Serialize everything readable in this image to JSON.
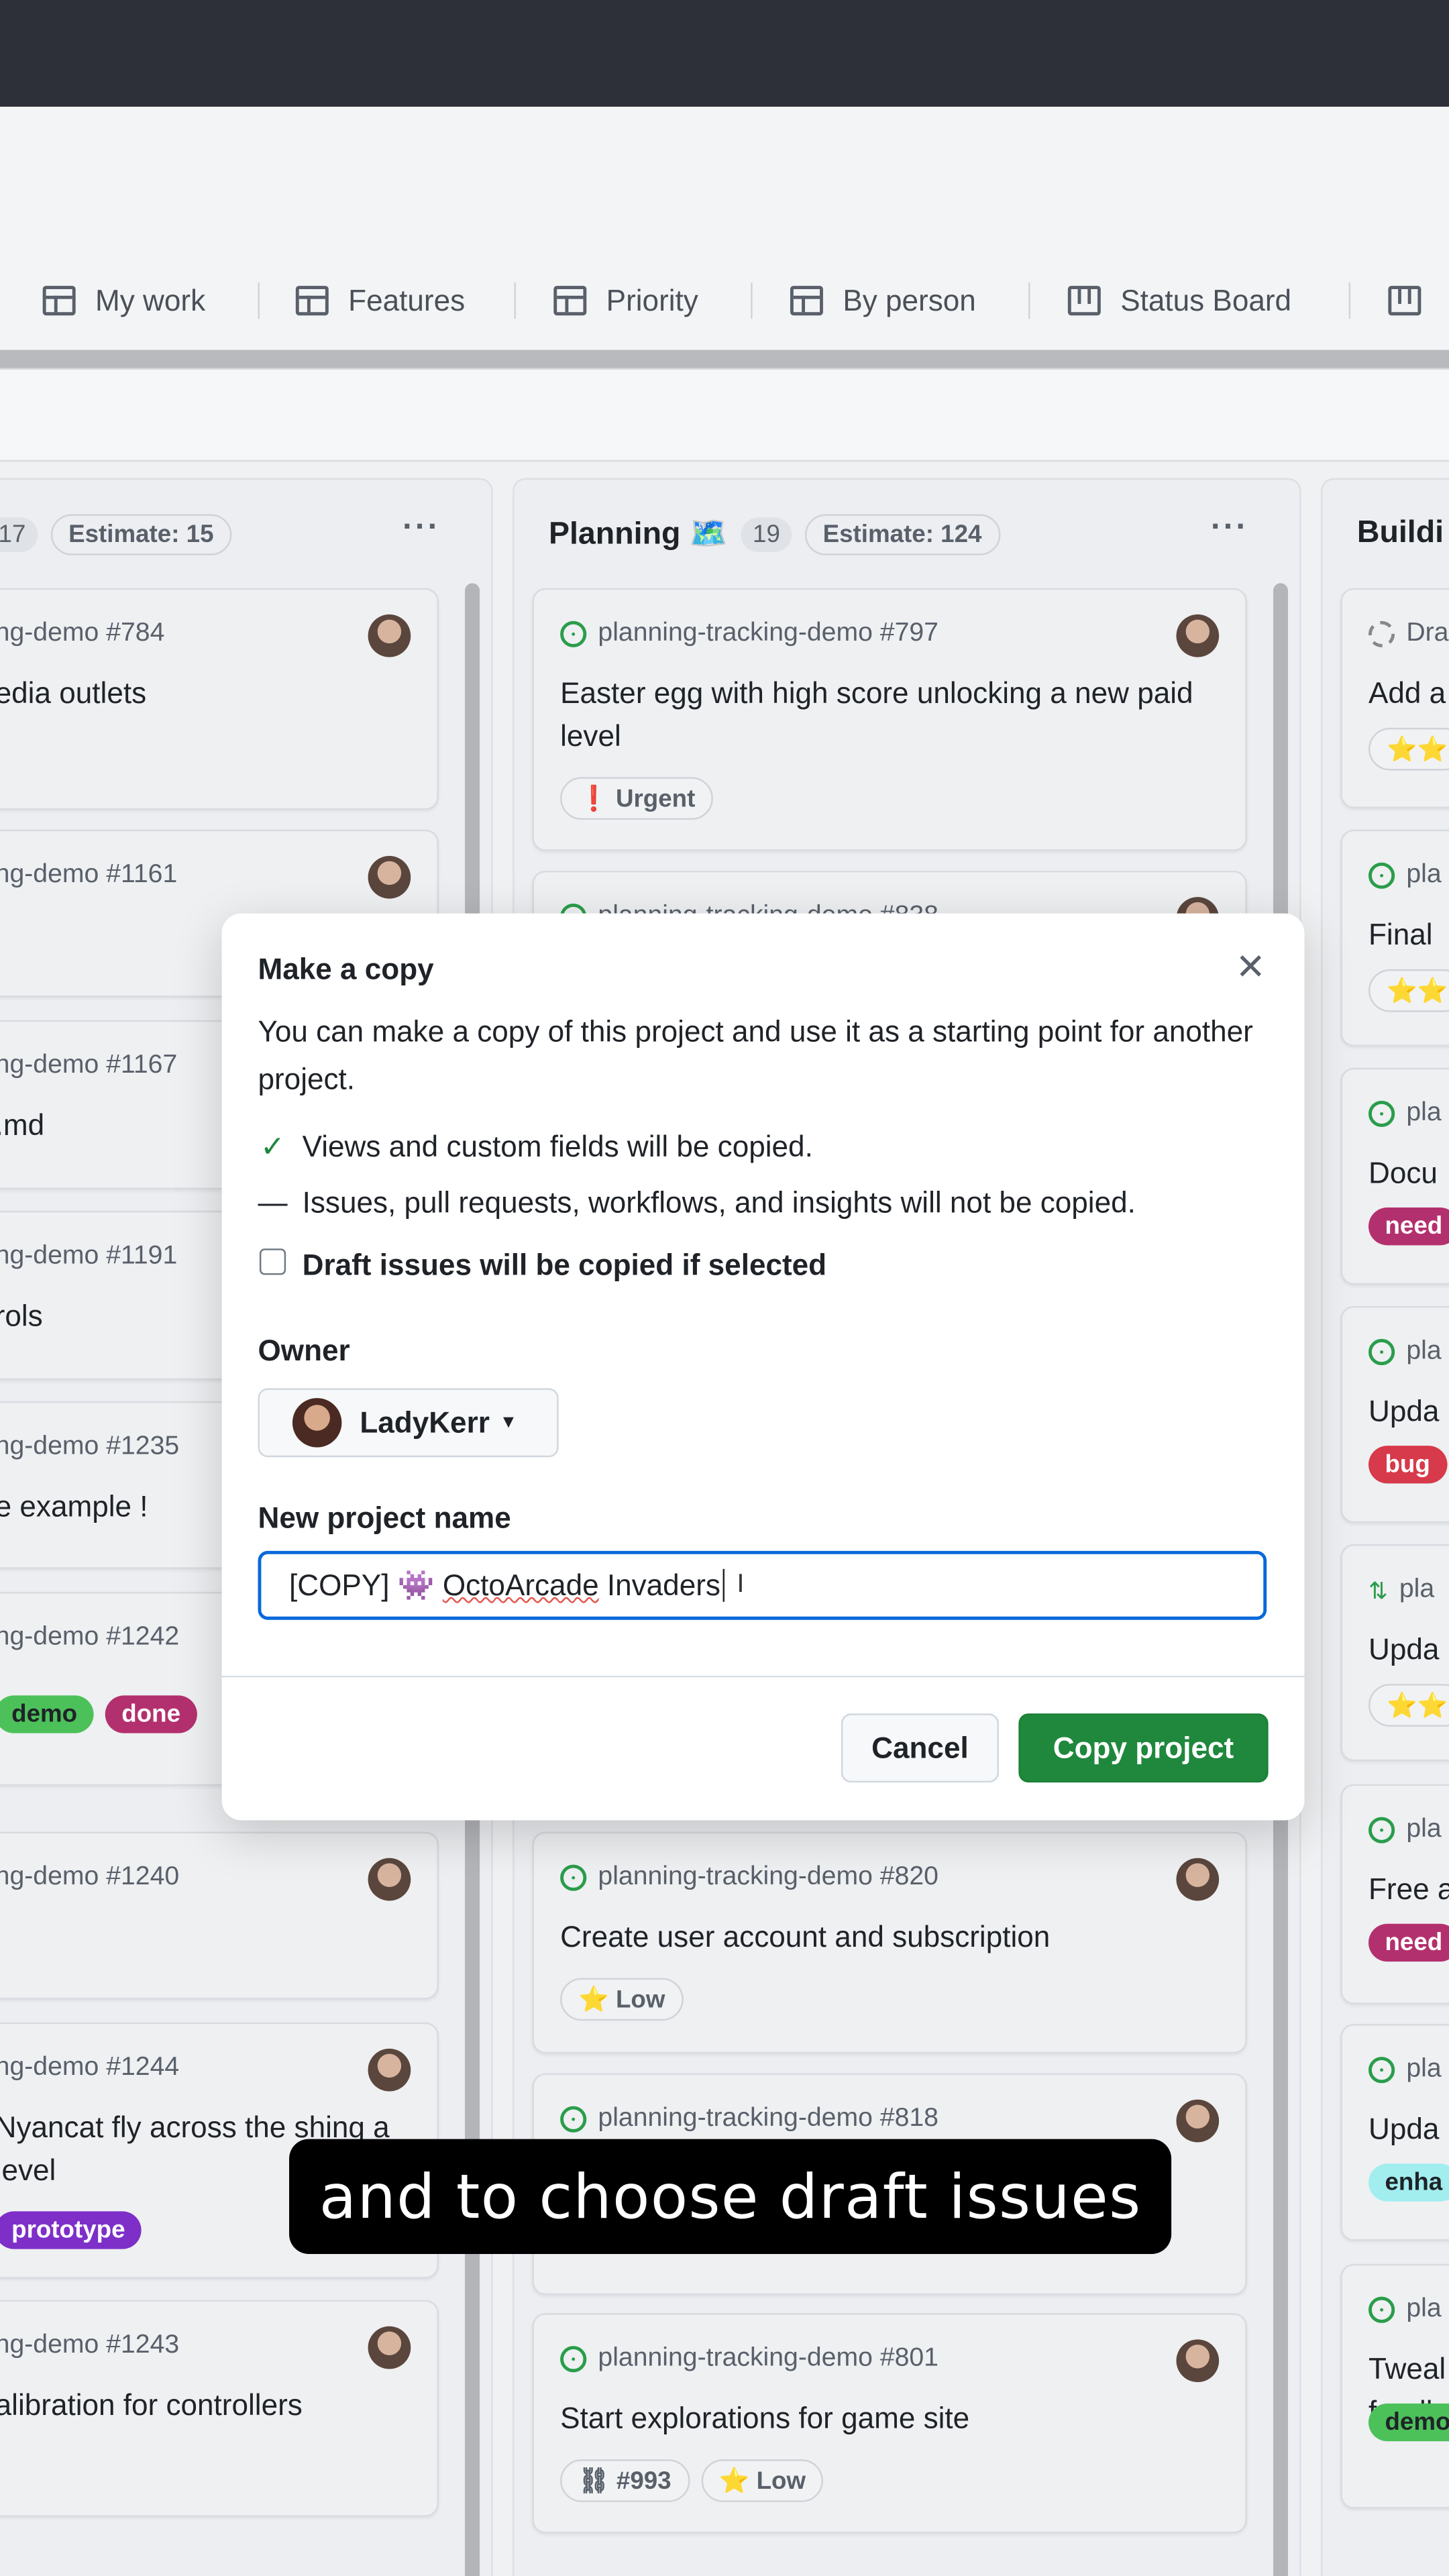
{
  "tabs": [
    {
      "label": "My work",
      "icon": "table-icon"
    },
    {
      "label": "Features",
      "icon": "table-icon"
    },
    {
      "label": "Priority",
      "icon": "table-icon"
    },
    {
      "label": "By person",
      "icon": "table-icon"
    },
    {
      "label": "Status Board",
      "icon": "board-icon"
    },
    {
      "label": "",
      "icon": "board-icon"
    }
  ],
  "columns": [
    {
      "title": "",
      "count": "17",
      "estimate": "Estimate: 15",
      "more": "···",
      "cards": [
        {
          "ref": "ng-demo #784",
          "title": "edia outlets",
          "labels": []
        },
        {
          "ref": "ng-demo #1161",
          "title": "",
          "labels": []
        },
        {
          "ref": "ng-demo #1167",
          "title": ".md",
          "labels": []
        },
        {
          "ref": "ng-demo #1191",
          "title": "rols",
          "labels": []
        },
        {
          "ref": "ng-demo #1235",
          "title": "e example !",
          "labels": []
        },
        {
          "ref": "ng-demo #1242",
          "title": "",
          "labels": [
            {
              "text": "demo",
              "bg": "#4cc15a",
              "fg": "#1f2328"
            },
            {
              "text": "done",
              "bg": "#b3306e",
              "fg": "#ffffff"
            }
          ]
        },
        {
          "ref": "ng-demo #1240",
          "title": "",
          "labels": []
        },
        {
          "ref": "ng-demo #1244",
          "title": "Nyancat fly across the shing a level",
          "labels": [
            {
              "text": "prototype",
              "bg": "#7e2fc8",
              "fg": "#ffffff"
            }
          ]
        },
        {
          "ref": "ng-demo #1243",
          "title": "alibration for controllers",
          "labels": []
        }
      ]
    },
    {
      "title": "Planning 🗺️",
      "count": "19",
      "estimate": "Estimate: 124",
      "more": "···",
      "cards": [
        {
          "ref": "planning-tracking-demo #797",
          "title": "Easter egg with high score unlocking a new paid level",
          "labels": [
            {
              "text": "❗ Urgent",
              "pill": true
            }
          ]
        },
        {
          "ref": "planning-tracking-demo #838",
          "title": "",
          "labels": []
        },
        {
          "ref": "planning-tracking-demo #820",
          "title": "Create user account and subscription",
          "labels": [
            {
              "text": "⭐ Low",
              "pill": true
            }
          ]
        },
        {
          "ref": "planning-tracking-demo #818",
          "title": "",
          "labels": []
        },
        {
          "ref": "planning-tracking-demo #801",
          "title": "Start explorations for game site",
          "labels": [
            {
              "text": "⛓ #993",
              "pill": true
            },
            {
              "text": "⭐ Low",
              "pill": true
            }
          ]
        }
      ]
    },
    {
      "title": "Buildi",
      "count": "",
      "estimate": "",
      "more": "",
      "cards": [
        {
          "ref": "Dra",
          "title": "Add a",
          "draft": true,
          "labels": [
            {
              "text": "⭐⭐",
              "pill": true
            }
          ]
        },
        {
          "ref": "pla",
          "title": "Final",
          "labels": [
            {
              "text": "⭐⭐",
              "pill": true
            }
          ]
        },
        {
          "ref": "pla",
          "title": "Docu",
          "labels": [
            {
              "text": "need",
              "bg": "#b3306e",
              "fg": "#ffffff"
            }
          ]
        },
        {
          "ref": "pla",
          "title": "Upda",
          "labels": [
            {
              "text": "bug",
              "bg": "#d73a4a",
              "fg": "#ffffff"
            }
          ]
        },
        {
          "ref": "pla",
          "title": "Upda",
          "pr": true,
          "labels": [
            {
              "text": "⭐⭐",
              "pill": true
            }
          ]
        },
        {
          "ref": "pla",
          "title": "Free a",
          "labels": [
            {
              "text": "need",
              "bg": "#b3306e",
              "fg": "#ffffff"
            }
          ]
        },
        {
          "ref": "pla",
          "title": "Upda",
          "labels": [
            {
              "text": "enha",
              "bg": "#a2eeef",
              "fg": "#1f2328"
            }
          ]
        },
        {
          "ref": "pla",
          "title": "Tweal feedb",
          "labels": [
            {
              "text": "demo",
              "bg": "#4cc15a",
              "fg": "#1f2328"
            }
          ]
        }
      ]
    }
  ],
  "modal": {
    "title": "Make a copy",
    "close": "✕",
    "description": "You can make a copy of this project and use it as a starting point for another project.",
    "copied_note": "Views and custom fields will be copied.",
    "not_copied_note": "Issues, pull requests, workflows, and insights will not be copied.",
    "draft_checkbox_label": "Draft issues will be copied if selected",
    "draft_checked": false,
    "owner_label": "Owner",
    "owner_value": "LadyKerr",
    "name_label": "New project name",
    "name_prefix": "[COPY] 👾 ",
    "name_underlined": "OctoArcade",
    "name_suffix": " Invaders",
    "cancel": "Cancel",
    "copy": "Copy project",
    "accent": "#1f883d"
  },
  "caption": "and to choose draft issues"
}
